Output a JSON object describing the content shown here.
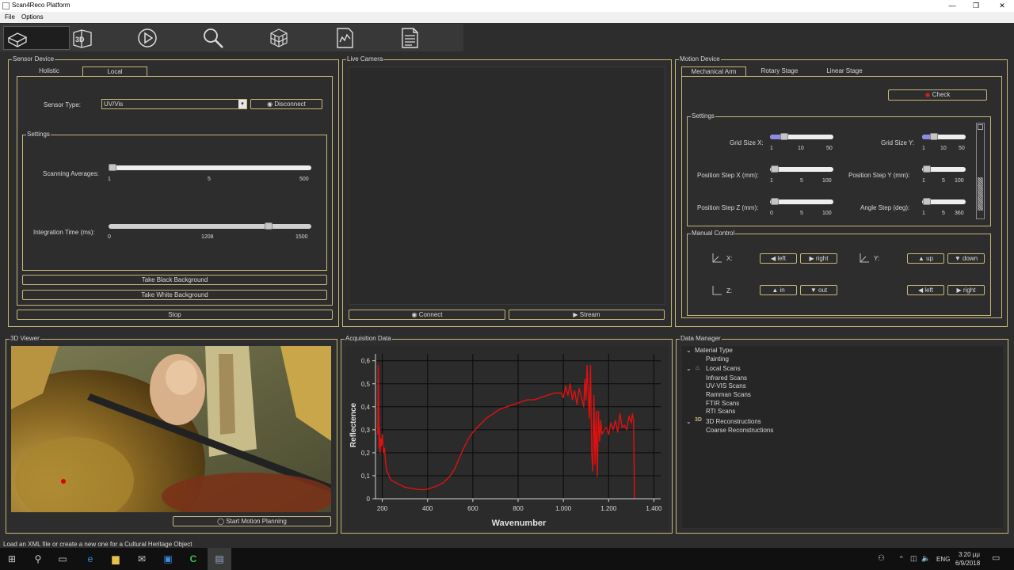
{
  "window": {
    "title": "Scan4Reco Platform",
    "controls": [
      "—",
      "❐",
      "✕"
    ]
  },
  "menu": {
    "items": [
      "File",
      "Options"
    ]
  },
  "toolbar": {
    "buttons": [
      "scan-object-icon",
      "3d-icon",
      "play-icon",
      "search-icon",
      "cube-grid-icon",
      "chart-doc-icon",
      "document-icon"
    ]
  },
  "sensor": {
    "title": "Sensor Device",
    "tabs": [
      "Holistic",
      "Local"
    ],
    "sensor_type_label": "Sensor Type:",
    "sensor_type_value": "UV/Vis",
    "disconnect_label": "Disconnect",
    "settings_title": "Settings",
    "scanning_averages_label": "Scanning Averages:",
    "scanning_averages": {
      "min": "1",
      "mid": "5",
      "max": "500",
      "value": 1
    },
    "integration_time_label": "Integration Time (ms):",
    "integration_time": {
      "min": "0",
      "mid": "1208",
      "max": "1500",
      "value": 1208
    },
    "black_bg_label": "Take Black Background",
    "white_bg_label": "Take White Background",
    "stop_label": "Stop"
  },
  "camera": {
    "title": "Live Camera",
    "connect_label": "Connect",
    "stream_label": "Stream"
  },
  "motion": {
    "title": "Motion Device",
    "tabs": [
      "Mechanical Arm",
      "Rotary Stage",
      "Linear Stage"
    ],
    "check_label": "Check",
    "settings_title": "Settings",
    "grid_x": {
      "label": "Grid Size X:",
      "ticks": [
        "1",
        "10",
        "50"
      ]
    },
    "grid_y": {
      "label": "Grid Size Y:",
      "ticks": [
        "1",
        "10",
        "50"
      ]
    },
    "pos_x": {
      "label": "Position Step X (mm):",
      "ticks": [
        "1",
        "5",
        "100"
      ]
    },
    "pos_y": {
      "label": "Position Step Y (mm):",
      "ticks": [
        "1",
        "5",
        "100"
      ]
    },
    "pos_z": {
      "label": "Position Step Z (mm):",
      "ticks": [
        "0",
        "5",
        "100"
      ]
    },
    "angle": {
      "label": "Angle Step (deg):",
      "ticks": [
        "1",
        "5",
        "360"
      ]
    },
    "manual_title": "Manual Control",
    "x_label": "X:",
    "y_label": "Y:",
    "z_label": "Z:",
    "left_label": "left",
    "right_label": "right",
    "up_label": "up",
    "down_label": "down",
    "in_label": "in",
    "out_label": "out"
  },
  "viewer": {
    "title": "3D Viewer",
    "start_label": "Start Motion Planning"
  },
  "acquisition": {
    "title": "Acquisition Data"
  },
  "chart_data": {
    "type": "line",
    "xlabel": "Wavenumber",
    "ylabel": "Reflectence",
    "xlim": [
      170,
      1430
    ],
    "ylim": [
      0,
      0.63
    ],
    "xticks": [
      "200",
      "400",
      "600",
      "800",
      "1.000",
      "1.200",
      "1.400"
    ],
    "yticks": [
      "0",
      "0,1",
      "0,2",
      "0,3",
      "0,4",
      "0,5",
      "0,6"
    ],
    "xtick_values": [
      200,
      400,
      600,
      800,
      1000,
      1200,
      1400
    ],
    "ytick_values": [
      0,
      0.1,
      0.2,
      0.3,
      0.4,
      0.5,
      0.6
    ],
    "grid": true,
    "series": [
      {
        "color": "#e01010",
        "x": [
          180,
          182,
          184,
          186,
          188,
          190,
          193,
          196,
          200,
          205,
          210,
          215,
          220,
          230,
          240,
          260,
          280,
          300,
          330,
          360,
          390,
          410,
          440,
          470,
          500,
          520,
          550,
          580,
          600,
          630,
          660,
          690,
          720,
          750,
          780,
          810,
          840,
          870,
          900,
          930,
          960,
          990,
          1000,
          1010,
          1020,
          1030,
          1040,
          1050,
          1060,
          1070,
          1080,
          1090,
          1095,
          1100,
          1105,
          1110,
          1115,
          1120,
          1125,
          1130,
          1135,
          1140,
          1145,
          1150,
          1155,
          1160,
          1165,
          1170,
          1180,
          1190,
          1200,
          1210,
          1220,
          1230,
          1240,
          1250,
          1260,
          1270,
          1280,
          1290,
          1300,
          1305,
          1310,
          1312,
          1314
        ],
        "y": [
          0.28,
          0.58,
          0.4,
          0.22,
          0.31,
          0.2,
          0.26,
          0.23,
          0.28,
          0.2,
          0.22,
          0.15,
          0.12,
          0.1,
          0.08,
          0.07,
          0.06,
          0.05,
          0.045,
          0.04,
          0.04,
          0.045,
          0.055,
          0.07,
          0.1,
          0.13,
          0.2,
          0.26,
          0.29,
          0.32,
          0.35,
          0.37,
          0.39,
          0.4,
          0.41,
          0.42,
          0.43,
          0.43,
          0.44,
          0.45,
          0.46,
          0.46,
          0.44,
          0.49,
          0.45,
          0.5,
          0.43,
          0.47,
          0.41,
          0.48,
          0.44,
          0.4,
          0.52,
          0.43,
          0.58,
          0.45,
          0.35,
          0.58,
          0.2,
          0.12,
          0.45,
          0.15,
          0.38,
          0.1,
          0.38,
          0.25,
          0.34,
          0.28,
          0.3,
          0.31,
          0.28,
          0.33,
          0.3,
          0.34,
          0.29,
          0.37,
          0.31,
          0.32,
          0.3,
          0.36,
          0.33,
          0.37,
          0.34,
          0.2,
          0
        ]
      }
    ]
  },
  "data_manager": {
    "title": "Data Manager",
    "material_type": "Material Type",
    "painting": "Painting",
    "local_scans": "Local Scans",
    "local_items": [
      "Infrared Scans",
      "UV-VIS Scans",
      "Ramman Scans",
      "FTIR Scans",
      "RTI Scans"
    ],
    "reconstructions": "3D Reconstructions",
    "coarse": "Coarse Reconstructions"
  },
  "status": {
    "message": "Load an XML file or create a new one for a Cultural Heritage Object"
  },
  "taskbar": {
    "time": "3:20 μμ",
    "date": "6/9/2018",
    "lang": "ENG",
    "icons": [
      "start-icon",
      "search-icon",
      "task-view-icon",
      "edge-icon",
      "explorer-icon",
      "mail-icon",
      "outlook-icon",
      "app-c-icon",
      "scan4reco-icon"
    ]
  }
}
